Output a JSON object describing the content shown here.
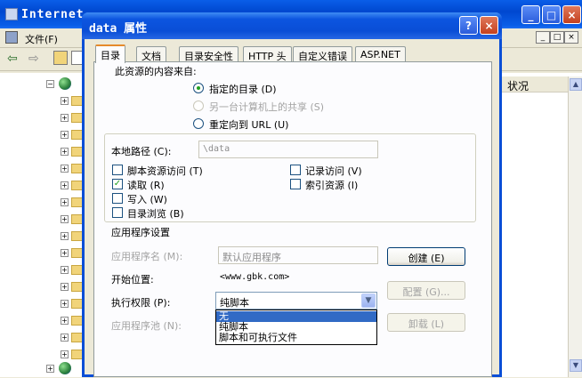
{
  "bg_window": {
    "title": "Internet",
    "menu": {
      "file": "文件(F)"
    },
    "status_column": "状况",
    "min_button": "_",
    "max_button": "□",
    "close_button": "×"
  },
  "dialog": {
    "title": "data 属性",
    "help_button": "?",
    "close_button": "×",
    "tabs": [
      {
        "label": "目录",
        "active": true
      },
      {
        "label": "文档"
      },
      {
        "label": "目录安全性"
      },
      {
        "label": "HTTP 头"
      },
      {
        "label": "自定义错误"
      },
      {
        "label": "ASP.NET"
      }
    ],
    "content_source_label": "此资源的内容来自:",
    "source_options": [
      {
        "label": "指定的目录 (D)",
        "selected": true
      },
      {
        "label": "另一台计算机上的共享 (S)",
        "disabled": true
      },
      {
        "label": "重定向到 URL (U)"
      }
    ],
    "local_path_label": "本地路径 (C):",
    "local_path_value": "\\data",
    "permissions": {
      "script_source": {
        "label": "脚本资源访问 (T)",
        "checked": false
      },
      "read": {
        "label": "读取 (R)",
        "checked": true
      },
      "write": {
        "label": "写入 (W)",
        "checked": false
      },
      "directory_browsing": {
        "label": "目录浏览 (B)",
        "checked": false
      },
      "log_visits": {
        "label": "记录访问 (V)",
        "checked": false
      },
      "index_resource": {
        "label": "索引资源 (I)",
        "checked": false
      }
    },
    "app_settings": {
      "heading": "应用程序设置",
      "app_name_label": "应用程序名 (M):",
      "app_name_value": "默认应用程序",
      "create_button": "创建 (E)",
      "start_point_label": "开始位置:",
      "start_point_value": "<www.gbk.com>",
      "config_button": "配置 (G)...",
      "exec_permissions_label": "执行权限 (P):",
      "exec_permissions_value": "纯脚本",
      "exec_options": [
        "无",
        "纯脚本",
        "脚本和可执行文件"
      ],
      "selected_option": "无",
      "app_pool_label": "应用程序池 (N):",
      "unload_button": "卸载 (L)",
      "checkmark": "✓"
    }
  },
  "colors": {
    "titlebar": "#0a4ed6",
    "selection": "#316ac5",
    "active_tab_accent": "#e68b2c"
  }
}
